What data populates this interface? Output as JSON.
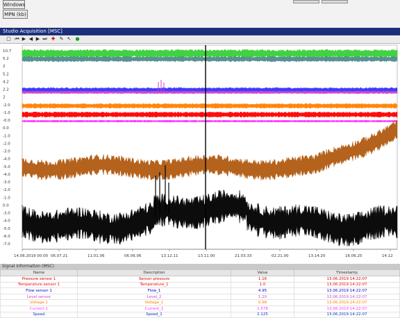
{
  "top": {
    "button1_label": "Windows",
    "button2_label": "MPN (kb)"
  },
  "window": {
    "title": "Studio Acquisition [MSC]"
  },
  "toolbar": {
    "icons": [
      "new-icon",
      "first-icon",
      "play-icon",
      "prev-icon",
      "next-icon",
      "last-icon",
      "zoom-icon",
      "settings-icon",
      "pointer-icon",
      "status-icon"
    ]
  },
  "chart_data": {
    "type": "line",
    "y_ticks": [
      "10.7",
      "5.2",
      "2",
      "5.2",
      "4.2",
      "2.2",
      "2",
      "-2.0",
      "-1.0",
      "-0.0",
      "0.0",
      "-1.0",
      "-2.0",
      "-3.0",
      "-4.0",
      "-5.0",
      "-4.0",
      "-3.0",
      "-2.0",
      "-1.0",
      "0.0",
      "-3.0",
      "-4.0",
      "-5.0",
      "-6.0",
      "-7.0"
    ],
    "x_ticks": [
      "14.06.2019 00:00",
      "06.07.21",
      "11.01.06",
      "06.06.06",
      "13.12.11",
      "13.11.00",
      "21.03.33",
      "02.21.00",
      "13.14.20",
      "16.06.25",
      "14.12"
    ],
    "series": [
      {
        "color": "#36d036",
        "band": [
          0.3,
          0.6
        ],
        "trend": "flat"
      },
      {
        "color": "#508c8c",
        "band": [
          0.1,
          0.4
        ],
        "trend": "flat"
      },
      {
        "color": "#3333ff",
        "band": [
          0.1,
          0.35
        ],
        "trend": "flat"
      },
      {
        "color": "#cc44cc",
        "band": [
          0.1,
          0.3
        ],
        "trend": "flat"
      },
      {
        "color": "#ff8000",
        "band": [
          0.1,
          0.35
        ],
        "trend": "flat"
      },
      {
        "color": "#ff0000",
        "band": [
          0.1,
          0.4
        ],
        "trend": "flat"
      },
      {
        "color": "#ff33ff",
        "band": [
          0.05,
          0.1
        ],
        "trend": "flat"
      },
      {
        "color": "#b05a10",
        "band": [
          0.3,
          0.8
        ],
        "trend": "rise-end"
      },
      {
        "color": "#000000",
        "band": [
          0.4,
          0.9
        ],
        "trend": "noisy-spikes"
      }
    ],
    "cursor_label": "13.11.00"
  },
  "footer": {
    "title": "Signal Information (MSC)",
    "columns": [
      "Name",
      "Description",
      "Value",
      "Timestamp"
    ],
    "rows": [
      {
        "name": "Pressure sensor 1",
        "desc": "Sensor pressure",
        "value": "1.16",
        "time": "13.06.2019 14:22:07",
        "color": "#cc0000"
      },
      {
        "name": "Temperature sensor 1",
        "desc": "Temperature_1",
        "value": "1.0",
        "time": "13.06.2019 14:22:07",
        "color": "#ff0000"
      },
      {
        "name": "Flow sensor 1",
        "desc": "Flow_1",
        "value": "4.95",
        "time": "13.06.2019 14:22:07",
        "color": "#0000cc"
      },
      {
        "name": "Level sensor",
        "desc": "Level_2",
        "value": "1.20",
        "time": "13.06.2019 14:22:07",
        "color": "#cc44cc"
      },
      {
        "name": "Voltage 1",
        "desc": "Voltage_1",
        "value": "0.98",
        "time": "13.06.2019 14:22:07",
        "color": "#ff8000"
      },
      {
        "name": "Current 1",
        "desc": "Current_1",
        "value": "1.578",
        "time": "13.06.2019 14:22:07",
        "color": "#ff33ff"
      },
      {
        "name": "Speed",
        "desc": "Speed_1",
        "value": "2.125",
        "time": "13.06.2019 14:22:07",
        "color": "#0033cc"
      }
    ]
  }
}
